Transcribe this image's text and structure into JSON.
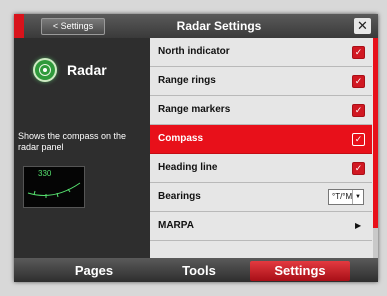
{
  "header": {
    "back_label": "< Settings",
    "title": "Radar Settings",
    "close_label": "✕"
  },
  "sidebar": {
    "app_name": "Radar",
    "description": "Shows the compass on the radar panel",
    "preview_value": "330"
  },
  "settings": {
    "rows": [
      {
        "label": "North indicator",
        "control": "checkbox",
        "checked": true
      },
      {
        "label": "Range rings",
        "control": "checkbox",
        "checked": true
      },
      {
        "label": "Range markers",
        "control": "checkbox",
        "checked": true
      },
      {
        "label": "Compass",
        "control": "checkbox",
        "checked": true,
        "selected": true
      },
      {
        "label": "Heading line",
        "control": "checkbox",
        "checked": true
      },
      {
        "label": "Bearings",
        "control": "select",
        "value": "°T/°M"
      },
      {
        "label": "MARPA",
        "control": "submenu"
      }
    ]
  },
  "tabs": [
    {
      "label": "Pages"
    },
    {
      "label": "Tools"
    },
    {
      "label": "Settings",
      "active": true
    }
  ],
  "colors": {
    "accent": "#e8101a",
    "radar_green": "#2f9a3b"
  }
}
